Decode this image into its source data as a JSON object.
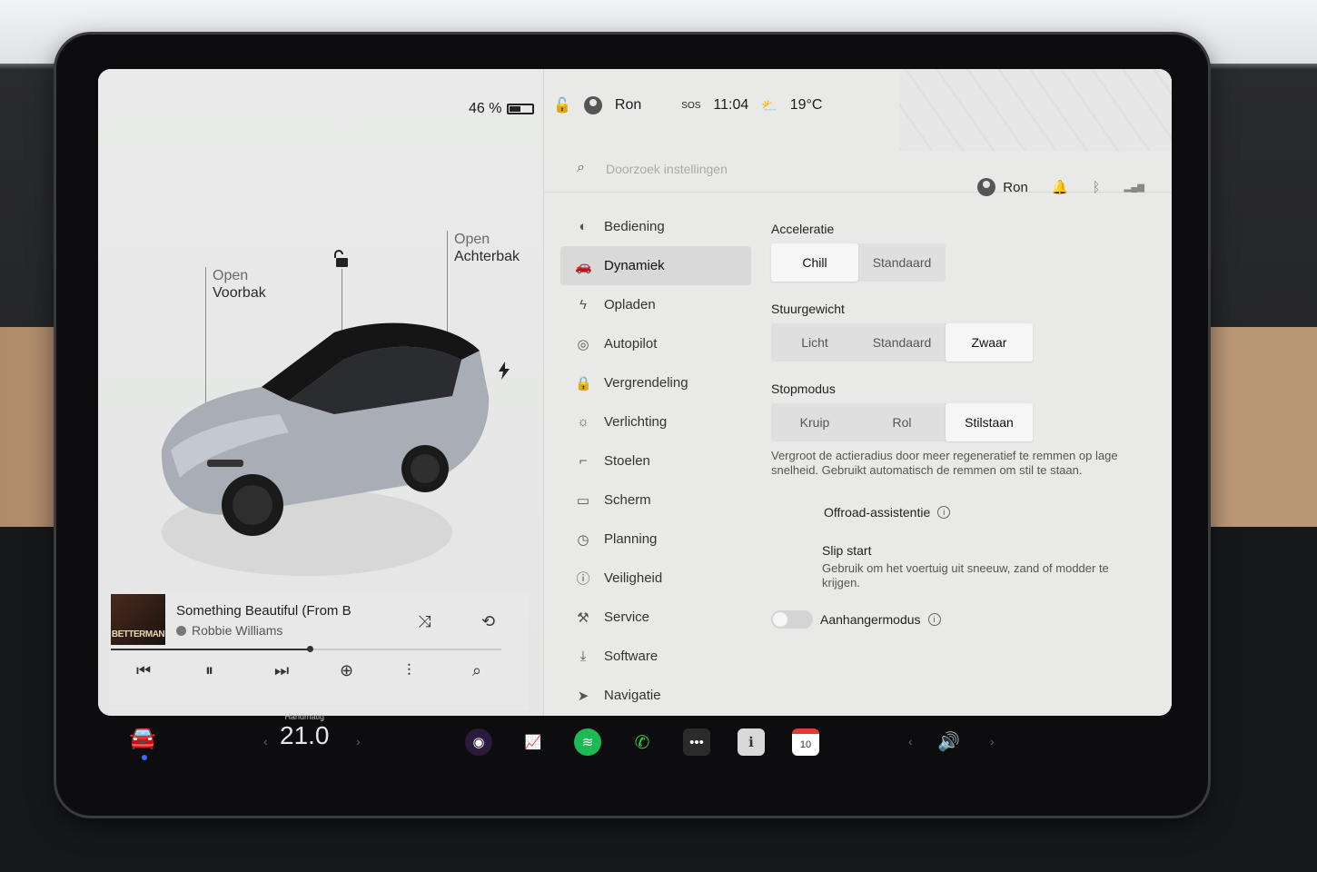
{
  "status": {
    "battery_percent": "46 %",
    "battery_level": 0.46,
    "user": "Ron",
    "sos": "SOS",
    "time": "11:04",
    "temperature": "19°C"
  },
  "car": {
    "front_label_small": "Open",
    "front_label": "Voorbak",
    "rear_label_small": "Open",
    "rear_label": "Achterbak"
  },
  "music": {
    "album_text": "BETTERMAN",
    "title": "Something Beautiful (From B",
    "artist": "Robbie Williams",
    "progress": 0.51
  },
  "settings": {
    "search_placeholder": "Doorzoek instellingen",
    "header_user": "Ron",
    "nav": [
      {
        "label": "Bediening",
        "icon": "toggle-icon"
      },
      {
        "label": "Dynamiek",
        "icon": "car-icon",
        "active": true
      },
      {
        "label": "Opladen",
        "icon": "bolt-icon"
      },
      {
        "label": "Autopilot",
        "icon": "steering-wheel-icon"
      },
      {
        "label": "Vergrendeling",
        "icon": "lock-icon"
      },
      {
        "label": "Verlichting",
        "icon": "light-icon"
      },
      {
        "label": "Stoelen",
        "icon": "seat-icon"
      },
      {
        "label": "Scherm",
        "icon": "display-icon"
      },
      {
        "label": "Planning",
        "icon": "clock-icon"
      },
      {
        "label": "Veiligheid",
        "icon": "info-icon"
      },
      {
        "label": "Service",
        "icon": "wrench-icon"
      },
      {
        "label": "Software",
        "icon": "download-icon"
      },
      {
        "label": "Navigatie",
        "icon": "navigation-icon"
      }
    ],
    "acceleration": {
      "title": "Acceleratie",
      "options": [
        "Chill",
        "Standaard"
      ],
      "selected": "Chill"
    },
    "steering": {
      "title": "Stuurgewicht",
      "options": [
        "Licht",
        "Standaard",
        "Zwaar"
      ],
      "selected": "Zwaar"
    },
    "stop_mode": {
      "title": "Stopmodus",
      "options": [
        "Kruip",
        "Rol",
        "Stilstaan"
      ],
      "selected": "Stilstaan",
      "description": "Vergroot de actieradius door meer regeneratief te remmen op lage snelheid. Gebruikt automatisch de remmen om stil te staan."
    },
    "offroad": {
      "title": "Offroad-assistentie"
    },
    "slip_start": {
      "title": "Slip start",
      "description": "Gebruik om het voertuig uit sneeuw, zand of modder te krijgen."
    },
    "trailer": {
      "title": "Aanhangermodus",
      "enabled": false
    }
  },
  "taskbar": {
    "climate_mode": "Handmatig",
    "climate_temp": "21.0",
    "calendar_day": "10"
  },
  "colors": {
    "spotify": "#1db954",
    "phone": "#2ecc40",
    "calendar": "#e53935",
    "stocks": "#2e7d32"
  }
}
